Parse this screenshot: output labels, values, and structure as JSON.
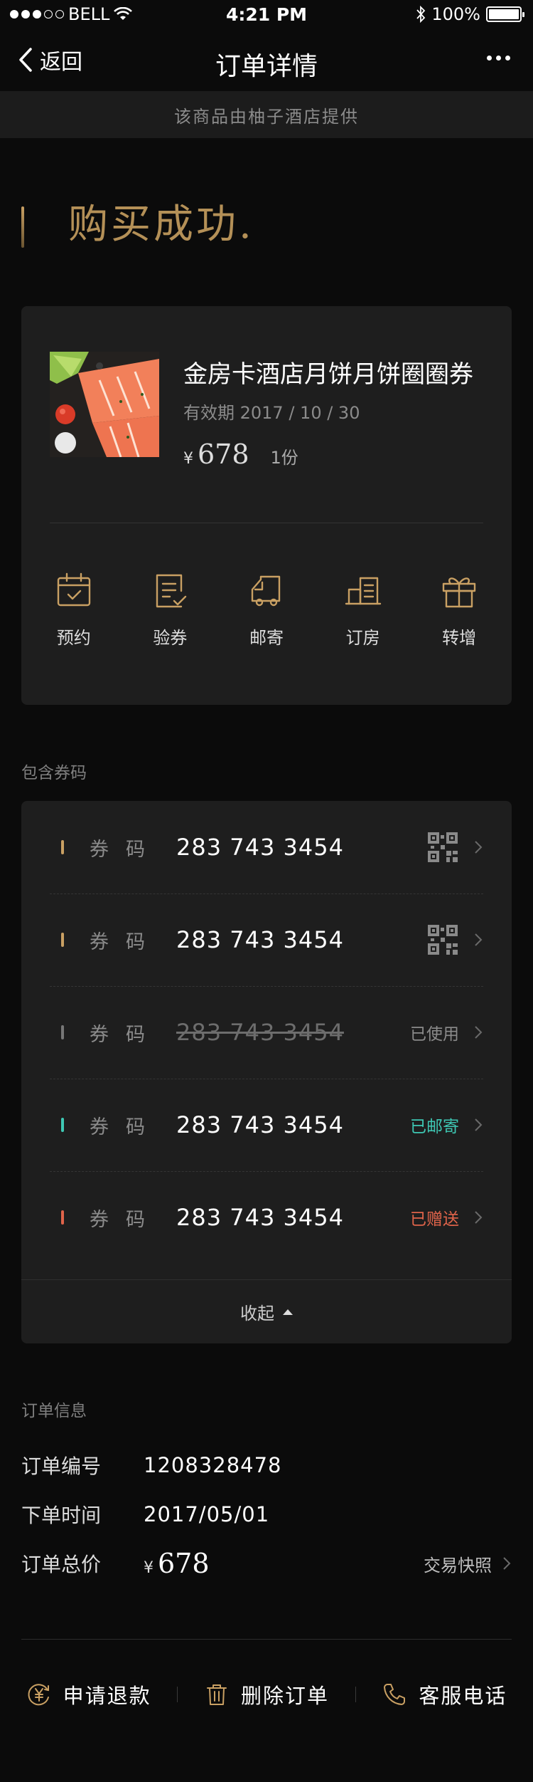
{
  "status_bar": {
    "carrier": "BELL",
    "time": "4:21 PM",
    "battery": "100%",
    "battery_level": 1.0
  },
  "nav": {
    "back_label": "返回",
    "title": "订单详情"
  },
  "notice": "该商品由柚子酒店提供",
  "success_text": "购买成功.",
  "product": {
    "name": "金房卡酒店月饼月饼圈圈券",
    "validity": "有效期 2017 / 10 / 30",
    "price_symbol": "¥",
    "price": "678",
    "quantity": "1份"
  },
  "actions": [
    {
      "label": "预约",
      "icon": "calendar-icon"
    },
    {
      "label": "验券",
      "icon": "verify-ticket-icon"
    },
    {
      "label": "邮寄",
      "icon": "delivery-truck-icon"
    },
    {
      "label": "订房",
      "icon": "hotel-building-icon"
    },
    {
      "label": "转增",
      "icon": "gift-icon"
    }
  ],
  "codes_section_title": "包含券码",
  "codes": [
    {
      "label": "券码",
      "number": "283 743 3454",
      "status": "",
      "bar_color": "#c9a063",
      "status_color": ""
    },
    {
      "label": "券码",
      "number": "283 743 3454",
      "status": "",
      "bar_color": "#c9a063",
      "status_color": ""
    },
    {
      "label": "券码",
      "number": "283 743 3454",
      "status": "已使用",
      "bar_color": "#777777",
      "status_color": "#8b8b8b"
    },
    {
      "label": "券码",
      "number": "283 743 3454",
      "status": "已邮寄",
      "bar_color": "#3ec8b4",
      "status_color": "#3ec8b4"
    },
    {
      "label": "券码",
      "number": "283 743 3454",
      "status": "已赠送",
      "bar_color": "#e0644a",
      "status_color": "#e0644a"
    }
  ],
  "collapse_label": "收起",
  "order_section_title": "订单信息",
  "order": {
    "number_label": "订单编号",
    "number": "1208328478",
    "time_label": "下单时间",
    "time": "2017/05/01",
    "total_label": "订单总价",
    "total_symbol": "¥",
    "total": "678",
    "snapshot_label": "交易快照"
  },
  "bottom": {
    "refund_label": "申请退款",
    "delete_label": "删除订单",
    "service_label": "客服电话"
  },
  "colors": {
    "accent_gold": "#b49057",
    "background": "#0b0b0b",
    "card": "#1e1e1e"
  }
}
